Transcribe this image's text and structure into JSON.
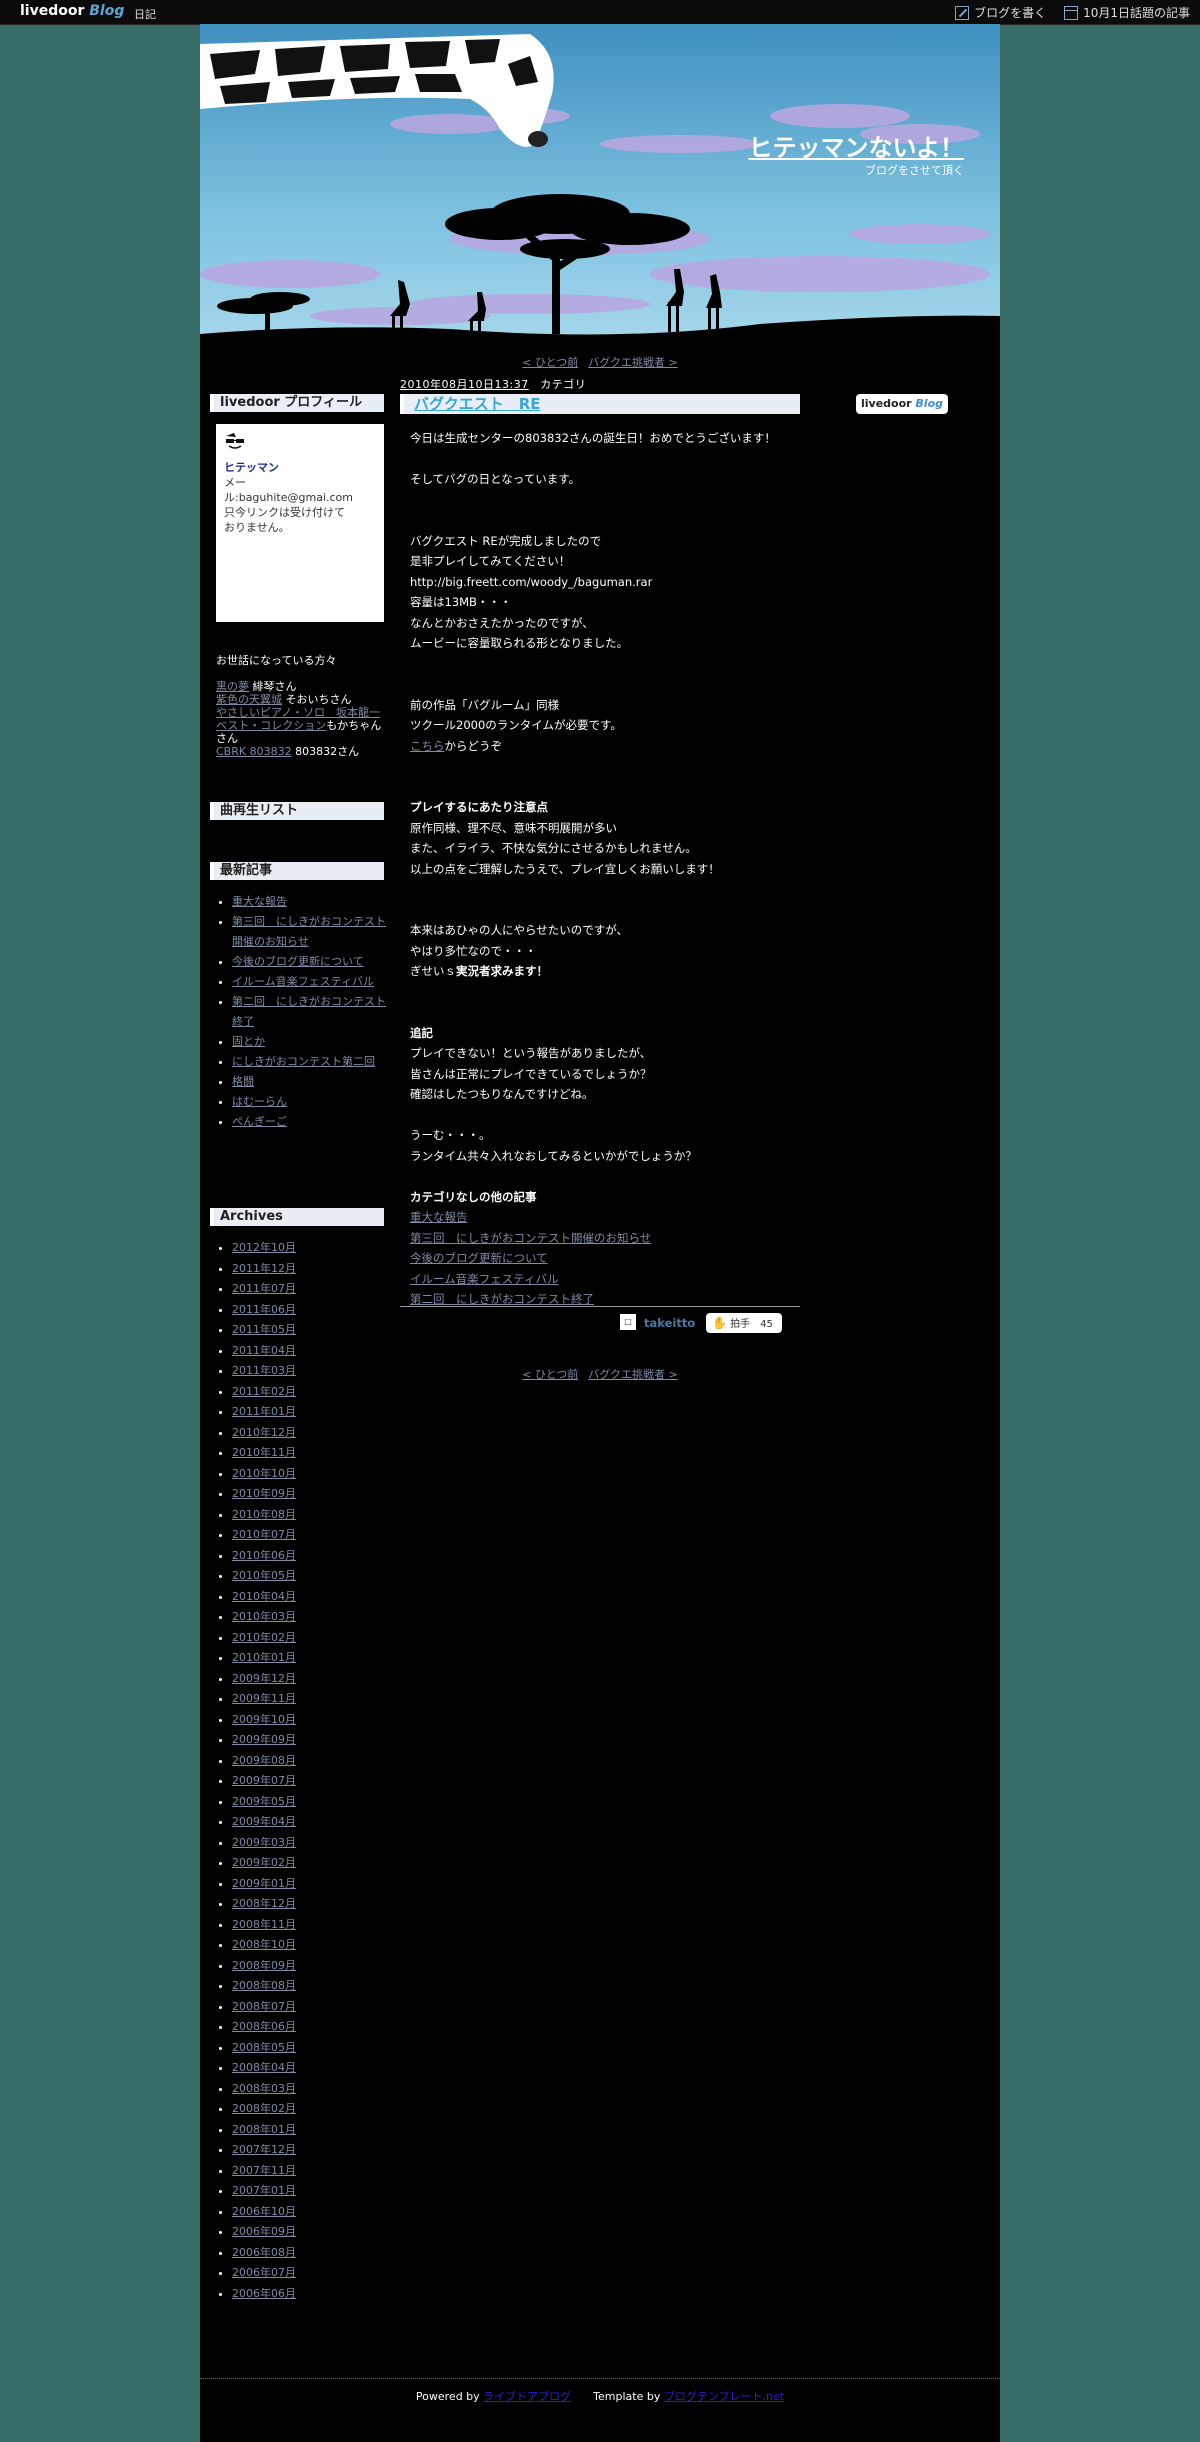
{
  "topbar": {
    "logo_main": "livedoor",
    "logo_sub": "Blog",
    "diary_label": "日記",
    "write_label": "ブログを書く",
    "topic_label": "10月1日話題の記事"
  },
  "blog": {
    "title": "ヒテッマンないよ！",
    "subtitle": "ブログをさせて頂く"
  },
  "pager": {
    "prev": "< ひとつ前",
    "next": "バグクエ挑戦者 >"
  },
  "profile": {
    "heading": "livedoor プロフィール",
    "name": "ヒテッマン",
    "line1": "メー",
    "line2": "ル:baguhite@gmai.com",
    "line3": "只今リンクは受け付けて",
    "line4": "おりません。"
  },
  "friends": {
    "heading": "お世話になっている方々",
    "entries": [
      {
        "link": "黒の夢",
        "text": " 緋琴さん"
      },
      {
        "link": "紫色の天翼城",
        "text": " そおいちさん"
      },
      {
        "link": "やさしいピアノ・ソロ　坂本龍一",
        "text": ""
      },
      {
        "link": "ベスト・コレクション",
        "text": "もかちゃんさん"
      },
      {
        "link": "CBRK 803832",
        "text": " 803832さん"
      }
    ]
  },
  "playlist": {
    "heading": "曲再生リスト"
  },
  "recent": {
    "heading": "最新記事",
    "items": [
      "重大な報告",
      "第三回　にしきがおコンテスト開催のお知らせ",
      "今後のブログ更新について",
      "イルーム音楽フェスティバル",
      "第二回　にしきがおコンテスト終了",
      "固とか",
      "にしきがおコンテスト第二回",
      "格闘",
      "はむーらん",
      "ぺんぎーご"
    ]
  },
  "archives": {
    "heading": "Archives",
    "items": [
      "2012年10月",
      "2011年12月",
      "2011年07月",
      "2011年06月",
      "2011年05月",
      "2011年04月",
      "2011年03月",
      "2011年02月",
      "2011年01月",
      "2010年12月",
      "2010年11月",
      "2010年10月",
      "2010年09月",
      "2010年08月",
      "2010年07月",
      "2010年06月",
      "2010年05月",
      "2010年04月",
      "2010年03月",
      "2010年02月",
      "2010年01月",
      "2009年12月",
      "2009年11月",
      "2009年10月",
      "2009年09月",
      "2009年08月",
      "2009年07月",
      "2009年05月",
      "2009年04月",
      "2009年03月",
      "2009年02月",
      "2009年01月",
      "2008年12月",
      "2008年11月",
      "2008年10月",
      "2008年09月",
      "2008年08月",
      "2008年07月",
      "2008年06月",
      "2008年05月",
      "2008年04月",
      "2008年03月",
      "2008年02月",
      "2008年01月",
      "2007年12月",
      "2007年11月",
      "2007年01月",
      "2006年10月",
      "2006年09月",
      "2006年08月",
      "2006年07月",
      "2006年06月"
    ]
  },
  "post": {
    "date": "2010年08月10日13:37",
    "category": "カテゴリ",
    "title": "バグクエスト　RE",
    "badge_main": "livedoor",
    "badge_sub": "Blog",
    "lines": {
      "l1": "今日は生成センターの803832さんの誕生日！おめでとうございます！",
      "l2": "そしてバグの日となっています。",
      "l3": "バグクエスト REが完成しましたので",
      "l4": "是非プレイしてみてください！",
      "l5": "http://big.freett.com/woody_/baguman.rar",
      "l6": "容量は13MB・・・",
      "l7": "なんとかおさえたかったのですが、",
      "l8": "ムービーに容量取られる形となりました。",
      "l9": "前の作品「バグルーム」同様",
      "l10": "ツクール2000のランタイムが必要です。",
      "l11_link": "こちら",
      "l11_text": "からどうぞ",
      "l12": "プレイするにあたり注意点",
      "l13": "原作同様、理不尽、意味不明展開が多い",
      "l14": "また、イライラ、不快な気分にさせるかもしれません。",
      "l15": "以上の点をご理解したうえで、プレイ宜しくお願いします！",
      "l16": "本来はあひゃの人にやらせたいのですが、",
      "l17": "やはり多忙なので・・・",
      "l18_a": "ぎせいｓ",
      "l18_b": "実況者求みます！",
      "l19": "追記",
      "l20": "プレイできない！という報告がありましたが、",
      "l21": "皆さんは正常にプレイできているでしょうか？",
      "l22": "確認はしたつもりなんですけどね。",
      "l23": "うーむ・・・。",
      "l24": "ランタイム共々入れなおしてみるといかがでしょうか？"
    },
    "related_heading": "カテゴリなしの他の記事",
    "related": [
      "重大な報告",
      "第三回　にしきがおコンテスト開催のお知らせ",
      "今後のブログ更新について",
      "イルーム音楽フェスティバル",
      "第二回　にしきがおコンテスト終了"
    ],
    "author": "takeitto",
    "clap_label": "拍手",
    "clap_count": "45"
  },
  "footer": {
    "powered_prefix": "Powered by ",
    "powered_link": "ライブドアブログ",
    "template_prefix": "Template by ",
    "template_link": "ブログテンプレート.net"
  },
  "colors": {
    "page_bg": "#376b66",
    "content_bg": "#000000",
    "link": "#7f8aa4",
    "title_link": "#38a6d6"
  }
}
